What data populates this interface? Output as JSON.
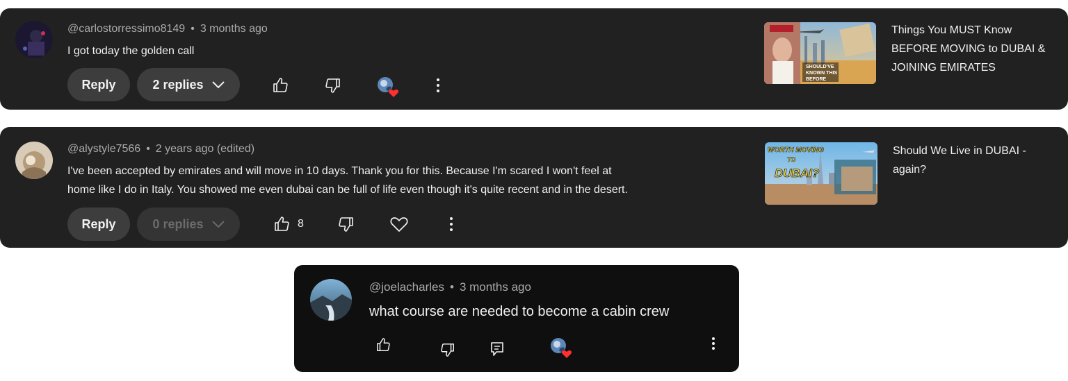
{
  "comments": [
    {
      "username": "@carlostorressimo8149",
      "time": "3 months ago",
      "text": "I got today the golden call",
      "reply_label": "Reply",
      "replies_label": "2 replies",
      "video_title": "Things You MUST Know BEFORE MOVING to DUBAI & JOINING EMIRATES",
      "thumb_texts": [
        "SHOULD'VE",
        "KNOWN THIS",
        "BEFORE"
      ]
    },
    {
      "username": "@alystyle7566",
      "time": "2 years ago (edited)",
      "text_lines": [
        "I've been accepted by emirates and will move in 10 days. Thank you for this. Because I'm scared I won't feel at",
        "home like I do in Italy. You showed me even dubai can be full of life even though it's quite recent and in the desert."
      ],
      "reply_label": "Reply",
      "replies_label": "0 replies",
      "like_count": "8",
      "video_title": "Should We Live in DUBAI - again?",
      "thumb_texts": [
        "WORTH MOVING",
        "TO",
        "DUBAI?"
      ]
    },
    {
      "username": "@joelacharles",
      "time": "3 months ago",
      "text": "what course are needed to become a cabin crew"
    }
  ],
  "separator": "•",
  "colors": {
    "card_bg": "#212121",
    "dark_card_bg": "#0f0f0f",
    "heart": "#ff3030"
  }
}
